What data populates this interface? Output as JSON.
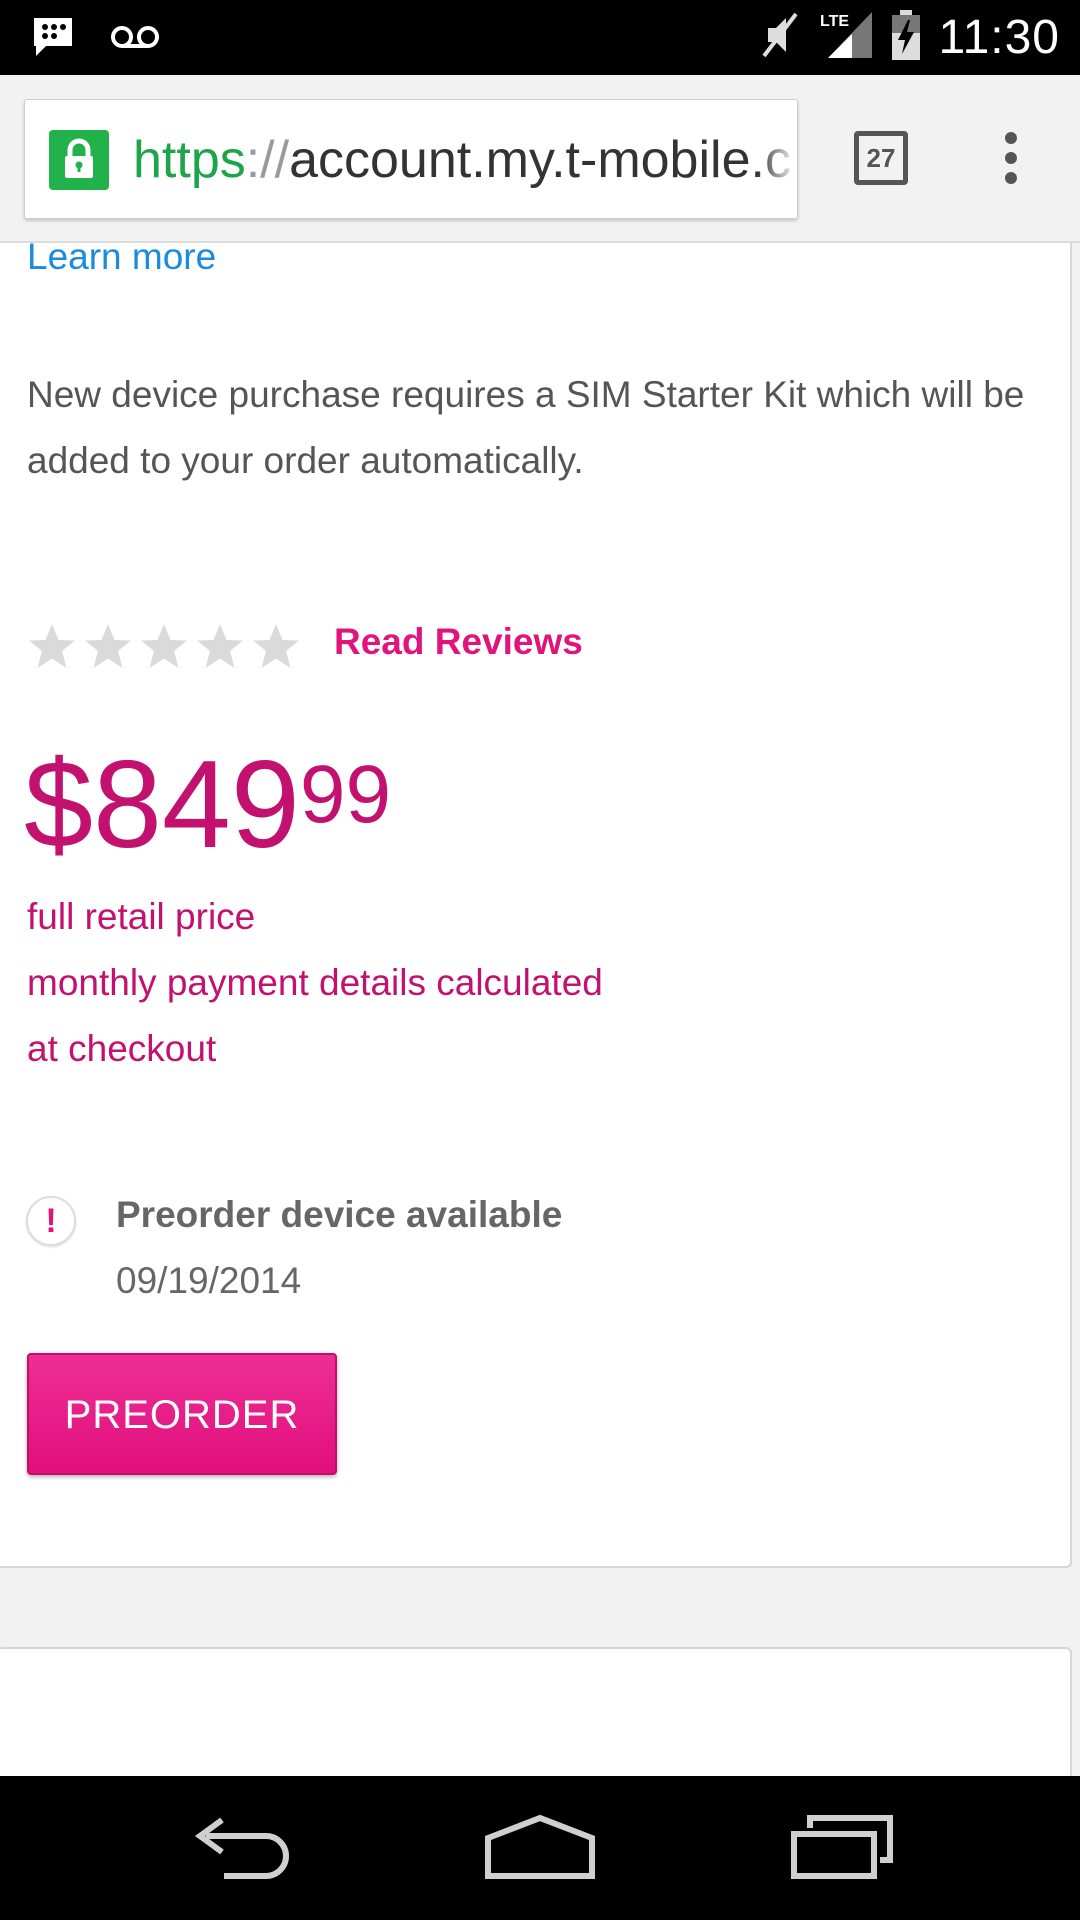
{
  "status_bar": {
    "left_icons": [
      "bbm-chat-icon",
      "voicemail-icon"
    ],
    "right_icons": [
      "mute-icon",
      "lte-signal-icon",
      "battery-charging-icon"
    ],
    "network": "LTE",
    "time": "11:30"
  },
  "browser": {
    "url_scheme": "https",
    "url_slashes": "://",
    "url_rest": "account.my.t-mobile.c",
    "tab_count": "27"
  },
  "content": {
    "learn_more": "Learn more",
    "sim_note": "New device purchase requires a SIM Starter Kit which will be added to your order automatically.",
    "rating": {
      "stars_filled": 0,
      "stars_total": 5
    },
    "read_reviews": "Read Reviews",
    "price_dollars": "$849",
    "price_cents": "99",
    "price_note_1": "full retail price",
    "price_note_2": "monthly payment details calculated",
    "price_note_3": "at checkout",
    "preorder_title": "Preorder device available",
    "preorder_date": "09/19/2014",
    "preorder_button": "PREORDER"
  },
  "colors": {
    "brand_magenta": "#e0147a",
    "price_magenta": "#c2116e",
    "link_blue": "#1b8be0",
    "secure_green": "#21b24b"
  }
}
